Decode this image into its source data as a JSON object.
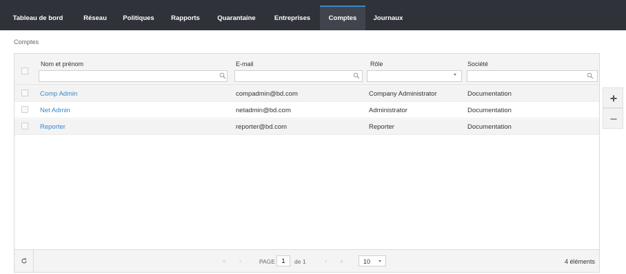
{
  "nav": {
    "items": [
      {
        "label": "Tableau de bord",
        "active": false
      },
      {
        "label": "Réseau",
        "active": false
      },
      {
        "label": "Politiques",
        "active": false
      },
      {
        "label": "Rapports",
        "active": false
      },
      {
        "label": "Quarantaine",
        "active": false
      },
      {
        "label": "Entreprises",
        "active": false
      },
      {
        "label": "Comptes",
        "active": true
      },
      {
        "label": "Journaux",
        "active": false
      }
    ]
  },
  "breadcrumb": "Comptes",
  "table": {
    "columns": [
      {
        "label": "Nom et prénom",
        "filter_value": ""
      },
      {
        "label": "E-mail",
        "filter_value": ""
      },
      {
        "label": "Rôle",
        "filter_value": ""
      },
      {
        "label": "Société",
        "filter_value": ""
      }
    ],
    "rows": [
      {
        "name": "Comp Admin",
        "email": "compadmin@bd.com",
        "role": "Company Administrator",
        "company": "Documentation"
      },
      {
        "name": "Net Admin",
        "email": "netadmin@bd.com",
        "role": "Administrator",
        "company": "Documentation"
      },
      {
        "name": "Reporter",
        "email": "reporter@bd.com",
        "role": "Reporter",
        "company": "Documentation"
      }
    ]
  },
  "pager": {
    "page_label": "PAGE",
    "page_value": "1",
    "of_label": "de 1",
    "page_size": "10",
    "items_count": "4 éléments"
  },
  "icons": {
    "search": "search-icon",
    "refresh": "refresh-icon",
    "add": "plus-icon",
    "remove": "minus-icon",
    "first": "first-page-icon",
    "prev": "prev-page-icon",
    "next": "next-page-icon",
    "last": "last-page-icon"
  },
  "colors": {
    "nav_bg": "#2f3238",
    "nav_active": "#40454d",
    "accent": "#3a87c8",
    "link": "#3a87c8"
  }
}
